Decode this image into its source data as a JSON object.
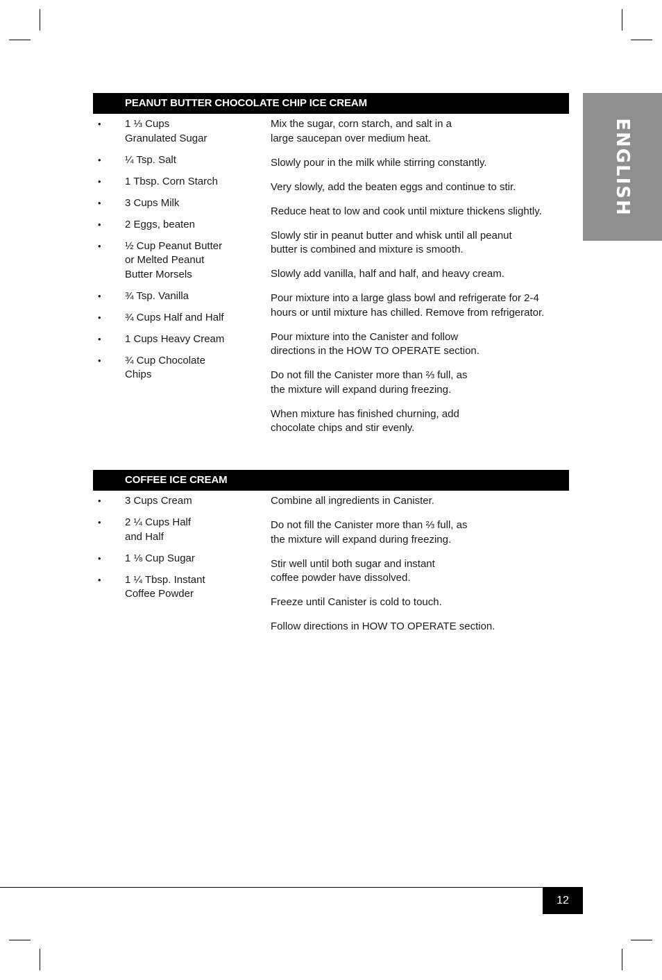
{
  "side_tab": {
    "label": "ENGLISH"
  },
  "page_number": "12",
  "recipes": [
    {
      "title": "PEANUT BUTTER CHOCOLATE CHIP ICE CREAM",
      "ingredients": [
        "1 ⅓ Cups\nGranulated Sugar",
        "¼ Tsp. Salt",
        "1 Tbsp. Corn Starch",
        "3 Cups Milk",
        "2 Eggs, beaten",
        "½ Cup Peanut Butter\nor Melted Peanut\nButter Morsels",
        "¾ Tsp. Vanilla",
        "¾ Cups Half and Half",
        "1 Cups Heavy Cream",
        "¾ Cup Chocolate\nChips"
      ],
      "steps": [
        "Mix the sugar, corn starch, and salt in a\nlarge saucepan over medium heat.",
        "Slowly pour in the milk while stirring constantly.",
        "Very slowly, add the beaten eggs and continue to stir.",
        "Reduce heat to low and cook until mixture thickens slightly.",
        "Slowly stir in peanut butter and whisk until all peanut\nbutter is combined and mixture is smooth.",
        "Slowly add vanilla, half and half, and heavy cream.",
        "Pour mixture into a large glass bowl and refrigerate for 2-4\nhours or until mixture has chilled. Remove from refrigerator.",
        "Pour mixture into the Canister and follow\ndirections in the HOW TO OPERATE section.",
        "Do not fill the Canister more than ⅔ full, as\nthe mixture will expand during freezing.",
        "When mixture has finished churning, add\nchocolate chips and stir evenly."
      ]
    },
    {
      "title": "COFFEE ICE CREAM",
      "ingredients": [
        "3 Cups Cream",
        "2 ¼ Cups Half\nand Half",
        "1 ⅛ Cup Sugar",
        "1 ¼ Tbsp. Instant\nCoffee Powder"
      ],
      "steps": [
        "Combine all ingredients in Canister.",
        "Do not fill the Canister more than ⅔ full, as\nthe mixture will expand during freezing.",
        "Stir well until both sugar and instant\ncoffee powder have dissolved.",
        "Freeze until Canister is cold to touch.",
        "Follow directions in HOW TO OPERATE section."
      ]
    }
  ],
  "bullet_glyph": "•"
}
